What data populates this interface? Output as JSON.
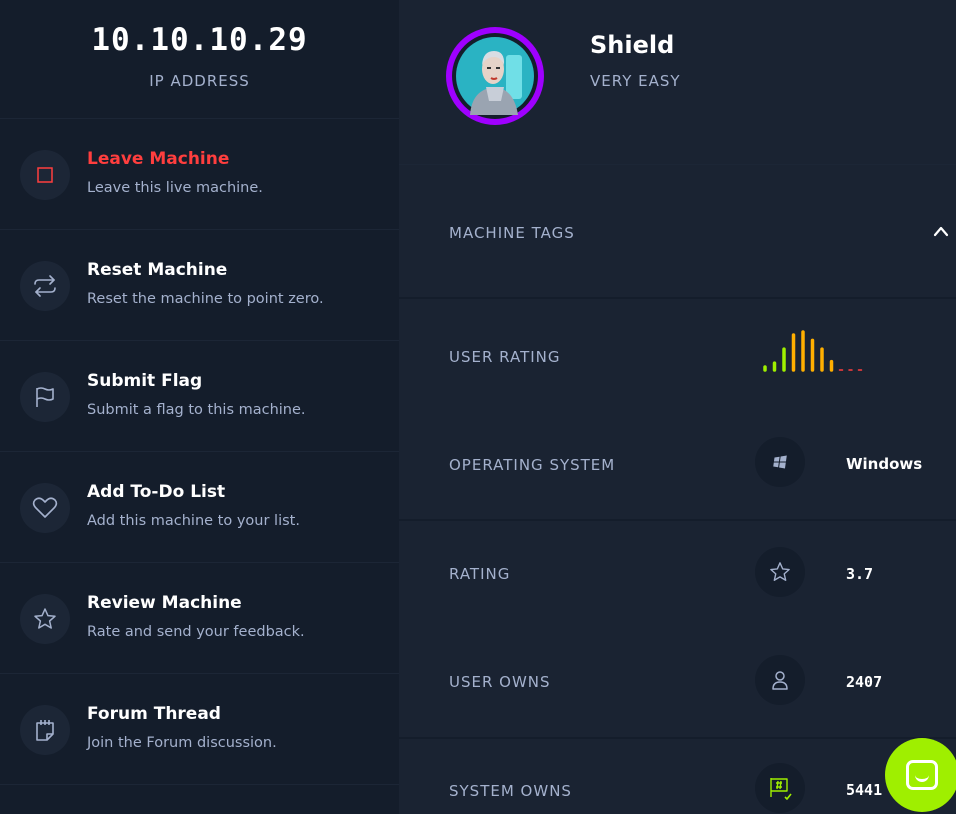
{
  "ip": {
    "value": "10.10.10.29",
    "label": "IP ADDRESS"
  },
  "actions": [
    {
      "title": "Leave Machine",
      "desc": "Leave this live machine.",
      "icon": "stop-icon"
    },
    {
      "title": "Reset Machine",
      "desc": "Reset the machine to point zero.",
      "icon": "reset-icon"
    },
    {
      "title": "Submit Flag",
      "desc": "Submit a flag to this machine.",
      "icon": "flag-icon"
    },
    {
      "title": "Add To-Do List",
      "desc": "Add this machine to your list.",
      "icon": "heart-icon"
    },
    {
      "title": "Review Machine",
      "desc": "Rate and send your feedback.",
      "icon": "star-icon"
    },
    {
      "title": "Forum Thread",
      "desc": "Join the Forum discussion.",
      "icon": "notepad-icon"
    }
  ],
  "machine": {
    "name": "Shield",
    "difficulty": "VERY EASY"
  },
  "details": {
    "tags_label": "MACHINE TAGS",
    "user_rating_label": "USER RATING",
    "os_label": "OPERATING SYSTEM",
    "os_value": "Windows",
    "rating_label": "RATING",
    "rating_value": "3.7",
    "user_owns_label": "USER OWNS",
    "user_owns_value": "2407",
    "system_owns_label": "SYSTEM OWNS",
    "system_owns_value": "5441"
  },
  "rating_bars": [
    {
      "level": 0.08,
      "color": "#9fef00"
    },
    {
      "level": 0.18,
      "color": "#9fef00"
    },
    {
      "level": 0.55,
      "color": "#9fef00"
    },
    {
      "level": 0.92,
      "color": "#ffaf00"
    },
    {
      "level": 1.0,
      "color": "#ffaf00"
    },
    {
      "level": 0.78,
      "color": "#ffaf00"
    },
    {
      "level": 0.55,
      "color": "#ffaf00"
    },
    {
      "level": 0.22,
      "color": "#ffaf00"
    },
    {
      "level": 0.03,
      "color": "#ff3e3e"
    },
    {
      "level": 0.03,
      "color": "#ff3e3e"
    },
    {
      "level": 0.03,
      "color": "#ff3e3e"
    }
  ],
  "colors": {
    "accent_green": "#9fef00",
    "danger": "#ff3e3e",
    "avatar_ring": "#9f00ff",
    "panel": "#141d2b",
    "background": "#1a2332"
  }
}
